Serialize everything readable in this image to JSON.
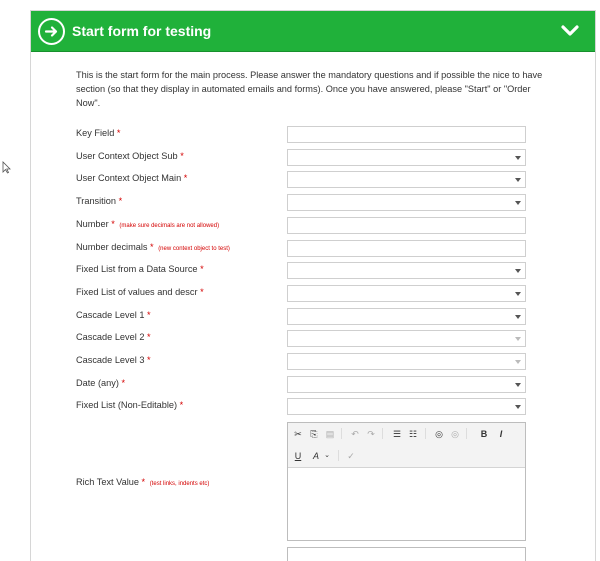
{
  "header": {
    "title": "Start form for testing"
  },
  "intro": "This is the start form for the main process. Please answer the mandatory questions and if possible the nice to have section (so that they display in automated emails and forms). Once you have answered, please \"Start\" or \"Order Now\".",
  "required_mark": "*",
  "info_glyph": "i",
  "fields": [
    {
      "label": "Key Field",
      "note": "",
      "type": "text"
    },
    {
      "label": "User Context Object Sub",
      "note": "",
      "type": "select"
    },
    {
      "label": "User Context Object Main",
      "note": "",
      "type": "select"
    },
    {
      "label": "Transition",
      "note": "",
      "type": "select"
    },
    {
      "label": "Number",
      "note": "(make sure decimals are not allowed)",
      "type": "text"
    },
    {
      "label": "Number decimals",
      "note": "(new context object to test)",
      "type": "text"
    },
    {
      "label": "Fixed List from a Data Source",
      "note": "",
      "type": "select"
    },
    {
      "label": "Fixed List of values and descr",
      "note": "",
      "type": "select"
    },
    {
      "label": "Cascade Level 1",
      "note": "",
      "type": "select"
    },
    {
      "label": "Cascade Level 2",
      "note": "",
      "type": "select-disabled"
    },
    {
      "label": "Cascade Level 3",
      "note": "",
      "type": "select-disabled"
    },
    {
      "label": "Date (any)",
      "note": "",
      "type": "select"
    },
    {
      "label": "Fixed List (Non-Editable)",
      "note": "",
      "type": "select"
    }
  ],
  "rich_text": {
    "label": "Rich Text Value",
    "note": "(test links, indents etc)"
  },
  "toolbar": {
    "bold": "B",
    "italic": "I",
    "underline": "U"
  }
}
